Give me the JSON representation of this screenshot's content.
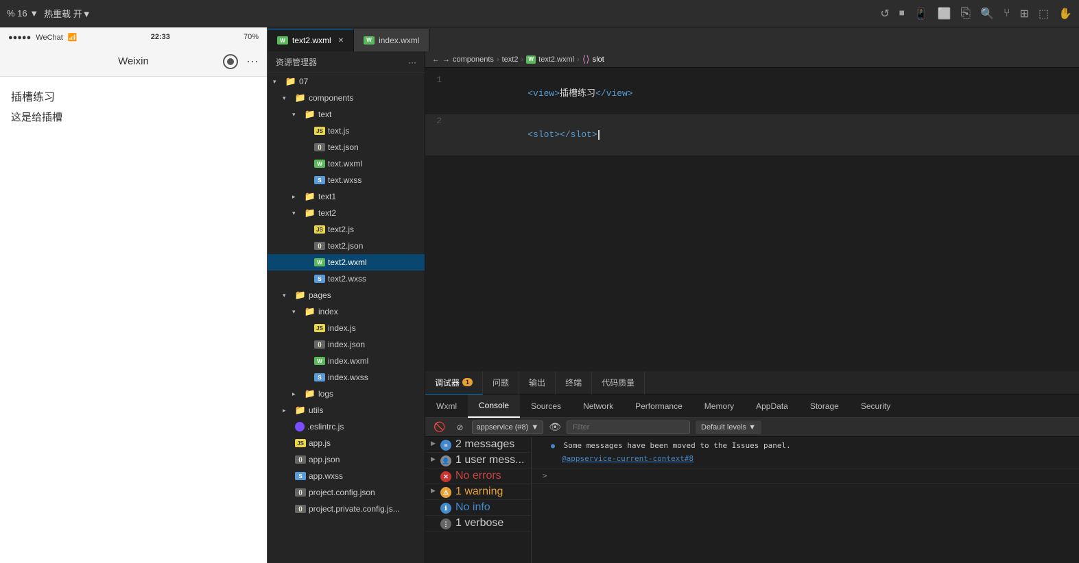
{
  "topbar": {
    "left": {
      "percent": "% 16 ▼",
      "hotreload": "热重载 开▼"
    },
    "icons": [
      "↺",
      "⏹",
      "📱",
      "⬜",
      "📋",
      "🔍",
      "⑂",
      "⊞",
      "⬚",
      "✋"
    ]
  },
  "tabs": {
    "items": [
      {
        "id": "text2wxml",
        "label": "text2.wxml",
        "icon_type": "wxml",
        "active": true,
        "closable": true
      },
      {
        "id": "indexwxml",
        "label": "index.wxml",
        "icon_type": "wxml",
        "active": false,
        "closable": false
      }
    ]
  },
  "breadcrumb": {
    "items": [
      "components",
      "text2",
      "text2.wxml",
      "slot"
    ]
  },
  "file_sidebar": {
    "title": "资源管理器",
    "more_icon": "...",
    "tree": [
      {
        "id": "07",
        "label": "07",
        "type": "folder",
        "indent": 0,
        "expanded": true
      },
      {
        "id": "components",
        "label": "components",
        "type": "folder",
        "indent": 1,
        "expanded": true
      },
      {
        "id": "text",
        "label": "text",
        "type": "folder",
        "indent": 2,
        "expanded": true
      },
      {
        "id": "text.js",
        "label": "text.js",
        "type": "js",
        "indent": 3
      },
      {
        "id": "text.json",
        "label": "text.json",
        "type": "json",
        "indent": 3
      },
      {
        "id": "text.wxml",
        "label": "text.wxml",
        "type": "wxml",
        "indent": 3
      },
      {
        "id": "text.wxss",
        "label": "text.wxss",
        "type": "wxss",
        "indent": 3
      },
      {
        "id": "text1",
        "label": "text1",
        "type": "folder",
        "indent": 2,
        "expanded": false
      },
      {
        "id": "text2",
        "label": "text2",
        "type": "folder",
        "indent": 2,
        "expanded": true
      },
      {
        "id": "text2.js",
        "label": "text2.js",
        "type": "js",
        "indent": 3
      },
      {
        "id": "text2.json",
        "label": "text2.json",
        "type": "json",
        "indent": 3
      },
      {
        "id": "text2.wxml",
        "label": "text2.wxml",
        "type": "wxml",
        "indent": 3,
        "selected": true
      },
      {
        "id": "text2.wxss",
        "label": "text2.wxss",
        "type": "wxss",
        "indent": 3
      },
      {
        "id": "pages",
        "label": "pages",
        "type": "folder_special",
        "indent": 1,
        "expanded": true
      },
      {
        "id": "index_folder",
        "label": "index",
        "type": "folder",
        "indent": 2,
        "expanded": true
      },
      {
        "id": "index.js",
        "label": "index.js",
        "type": "js",
        "indent": 3
      },
      {
        "id": "index.json",
        "label": "index.json",
        "type": "json",
        "indent": 3
      },
      {
        "id": "index.wxml",
        "label": "index.wxml",
        "type": "wxml",
        "indent": 3
      },
      {
        "id": "index.wxss",
        "label": "index.wxss",
        "type": "wxss",
        "indent": 3
      },
      {
        "id": "logs",
        "label": "logs",
        "type": "folder",
        "indent": 2,
        "expanded": false
      },
      {
        "id": "utils",
        "label": "utils",
        "type": "folder",
        "indent": 1,
        "expanded": false
      },
      {
        "id": ".eslintrc.js",
        "label": ".eslintrc.js",
        "type": "eslint",
        "indent": 1
      },
      {
        "id": "app.js",
        "label": "app.js",
        "type": "js",
        "indent": 1
      },
      {
        "id": "app.json",
        "label": "app.json",
        "type": "json",
        "indent": 1
      },
      {
        "id": "app.wxss",
        "label": "app.wxss",
        "type": "wxss",
        "indent": 1
      },
      {
        "id": "project.config.json",
        "label": "project.config.json",
        "type": "json",
        "indent": 1
      },
      {
        "id": "project.private.config.js",
        "label": "project.private.config.js...",
        "type": "json",
        "indent": 1
      }
    ]
  },
  "code_editor": {
    "lines": [
      {
        "num": "1",
        "content": "<view>插槽练习</view>"
      },
      {
        "num": "2",
        "content": "<slot></slot>",
        "cursor": true
      }
    ]
  },
  "phone": {
    "signal": "●●●●●",
    "carrier": "WeChat",
    "wifi": "WiFi",
    "time": "22:33",
    "battery": "70%",
    "title": "Weixin",
    "content_line1": "插槽练习",
    "content_line2": "这是给插槽"
  },
  "ide_debug_tabs": [
    {
      "id": "debugger",
      "label": "调试器",
      "badge": "1",
      "active": true
    },
    {
      "id": "issues",
      "label": "问题",
      "active": false
    },
    {
      "id": "output",
      "label": "输出",
      "active": false
    },
    {
      "id": "terminal",
      "label": "终端",
      "active": false
    },
    {
      "id": "code_quality",
      "label": "代码质量",
      "active": false
    }
  ],
  "devtools_tabs": [
    {
      "id": "wxml",
      "label": "Wxml",
      "active": false
    },
    {
      "id": "console",
      "label": "Console",
      "active": true
    },
    {
      "id": "sources",
      "label": "Sources",
      "active": false
    },
    {
      "id": "network",
      "label": "Network",
      "active": false
    },
    {
      "id": "performance",
      "label": "Performance",
      "active": false
    },
    {
      "id": "memory",
      "label": "Memory",
      "active": false
    },
    {
      "id": "appdata",
      "label": "AppData",
      "active": false
    },
    {
      "id": "storage",
      "label": "Storage",
      "active": false
    },
    {
      "id": "security",
      "label": "Security",
      "active": false
    }
  ],
  "console_toolbar": {
    "service": "appservice (#8)",
    "filter_placeholder": "Filter",
    "levels": "Default levels ▼"
  },
  "console_messages": [
    {
      "id": "messages",
      "type": "messages",
      "expand": true,
      "count": "2 messages",
      "text": ""
    },
    {
      "id": "user",
      "type": "user",
      "expand": true,
      "count": "1 user mess...",
      "text": ""
    },
    {
      "id": "errors",
      "type": "error",
      "expand": false,
      "count": "",
      "text": "No errors"
    },
    {
      "id": "warning",
      "type": "warning",
      "expand": true,
      "count": "1 warning",
      "text": ""
    },
    {
      "id": "info",
      "type": "info",
      "expand": false,
      "count": "",
      "text": "No info"
    },
    {
      "id": "verbose",
      "type": "verbose",
      "expand": false,
      "count": "",
      "text": "1 verbose"
    }
  ],
  "info_message": {
    "line1": "Some messages have been moved to the Issues panel.",
    "link": "@appservice-current-context#8",
    "prompt": ">"
  }
}
